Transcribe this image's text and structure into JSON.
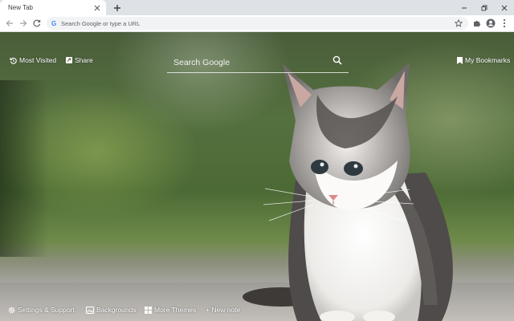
{
  "browser": {
    "tab_title": "New Tab",
    "omnibox_placeholder": "Search Google or type a URL"
  },
  "newtab": {
    "most_visited": "Most Visited",
    "share": "Share",
    "search_placeholder": "Search Google",
    "bookmarks": "My Bookmarks",
    "bottom": {
      "settings": "Settings & Support",
      "backgrounds": "Backgrounds",
      "themes": "More Themes",
      "new_note": "+ New note"
    }
  },
  "icons": {
    "tab_close": "close-icon",
    "new_tab": "plus-icon",
    "back": "arrow-back-icon",
    "forward": "arrow-forward-icon",
    "reload": "reload-icon",
    "bookmark_star": "star-icon",
    "extensions": "puzzle-icon",
    "profile": "account-circle-icon",
    "menu": "kebab-menu-icon"
  },
  "colors": {
    "tabstrip_bg": "#dee1e6",
    "toolbar_bg": "#ffffff",
    "omnibox_bg": "#f1f3f4",
    "overlay_text": "#ffffff"
  }
}
